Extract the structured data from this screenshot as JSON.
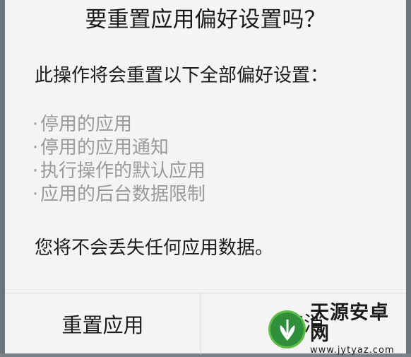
{
  "dialog": {
    "title": "要重置应用偏好设置吗？",
    "intro": "此操作将会重置以下全部偏好设置：",
    "items": [
      {
        "bullet": "·",
        "label": "停用的应用"
      },
      {
        "bullet": "·",
        "label": "停用的应用通知"
      },
      {
        "bullet": "·",
        "label": "执行操作的默认应用"
      },
      {
        "bullet": "·",
        "label": "应用的后台数据限制"
      }
    ],
    "note": "您将不会丢失任何应用数据。",
    "buttons": {
      "reset_label": "重置应用",
      "cancel_label": "取消"
    }
  },
  "watermark": {
    "name": "天源安卓网",
    "url": "www.jytyaz.com",
    "logo_color": "#2f8f3a"
  }
}
